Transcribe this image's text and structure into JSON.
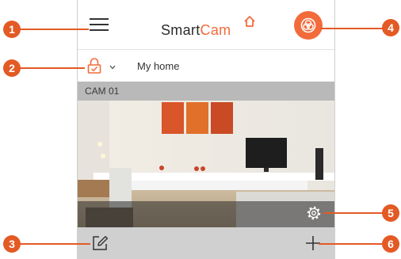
{
  "app": {
    "logo_text_1": "Smart",
    "logo_text_2": "Cam"
  },
  "header": {
    "menu_icon": "hamburger-icon",
    "action_icon": "camera-mode-icon"
  },
  "home": {
    "name": "My home",
    "lock_icon": "lock-icon",
    "dropdown_icon": "chevron-down-icon"
  },
  "camera": {
    "name": "CAM 01",
    "settings_icon": "gear-icon"
  },
  "footer": {
    "edit_icon": "edit-icon",
    "add_icon": "plus-icon"
  },
  "callouts": [
    "1",
    "2",
    "3",
    "4",
    "5",
    "6"
  ],
  "colors": {
    "accent": "#f26b3a",
    "callout": "#e35a24",
    "cam_header": "#b9b9b9",
    "bottom_bar": "#d0d0d0"
  }
}
